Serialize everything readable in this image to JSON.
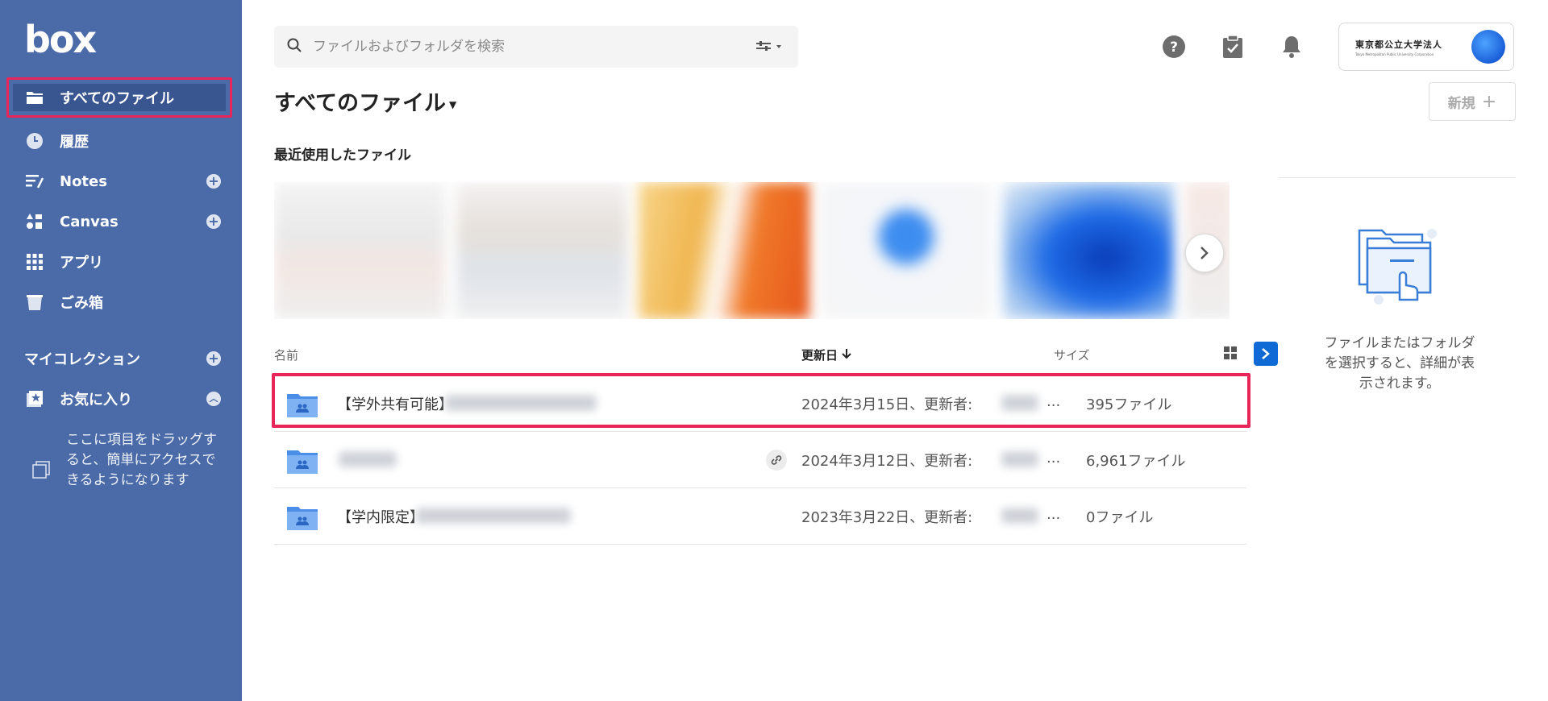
{
  "brand": {
    "logo": "box",
    "sidebar_color": "#4a6aa8",
    "accent": "#e8265a",
    "primary": "#0f6ad6"
  },
  "sidebar": {
    "items": [
      {
        "label": "すべてのファイル",
        "icon": "folder-icon"
      },
      {
        "label": "履歴",
        "icon": "clock-icon"
      },
      {
        "label": "Notes",
        "icon": "notes-icon"
      },
      {
        "label": "Canvas",
        "icon": "canvas-icon"
      },
      {
        "label": "アプリ",
        "icon": "apps-grid-icon"
      },
      {
        "label": "ごみ箱",
        "icon": "trash-icon"
      }
    ],
    "my_collections": "マイコレクション",
    "favorites": "お気に入り",
    "favorites_hint": "ここに項目をドラッグすると、簡単にアクセスできるようになります"
  },
  "search": {
    "placeholder": "ファイルおよびフォルダを検索"
  },
  "account": {
    "org": "東京都公立大学法人",
    "org_sub": "Tokyo Metropolitan Public University Corporation"
  },
  "page": {
    "title": "すべてのファイル",
    "new_button": "新規",
    "recent_title": "最近使用したファイル"
  },
  "table": {
    "headers": {
      "name": "名前",
      "modified": "更新日",
      "size": "サイズ"
    },
    "rows": [
      {
        "name": "【学外共有可能】",
        "date": "2024年3月15日、更新者:",
        "ellipsis": "...",
        "size": "395ファイル"
      },
      {
        "name": "",
        "date": "2024年3月12日、更新者:",
        "ellipsis": "...",
        "size": "6,961ファイル"
      },
      {
        "name": "【学内限定】",
        "date": "2023年3月22日、更新者:",
        "ellipsis": "...",
        "size": "0ファイル"
      }
    ]
  },
  "details_panel": {
    "empty_text": "ファイルまたはフォルダを選択すると、詳細が表示されます。"
  }
}
